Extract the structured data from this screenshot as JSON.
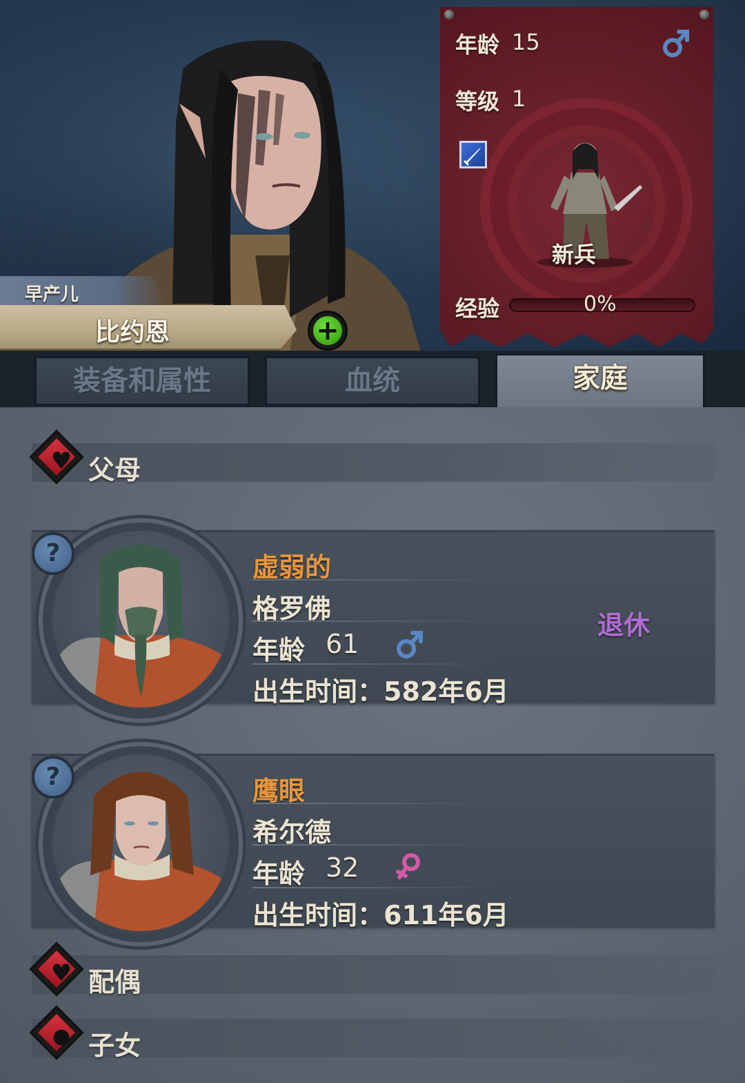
{
  "hero": {
    "trait": "早产儿",
    "name": "比约恩",
    "add_button": "+"
  },
  "banner": {
    "age_label": "年龄",
    "age_value": "15",
    "level_label": "等级",
    "level_value": "1",
    "class_name": "新兵",
    "xp_label": "经验",
    "xp_value": "0%",
    "xp_fraction": 0.0,
    "gender_icon": "male-icon",
    "class_icon": "dagger-icon"
  },
  "tabs": [
    {
      "label": "装备和属性",
      "active": false
    },
    {
      "label": "血统",
      "active": false
    },
    {
      "label": "家庭",
      "active": true
    }
  ],
  "sections": {
    "parents": {
      "label": "父母",
      "icon": "heart-icon"
    },
    "spouse": {
      "label": "配偶",
      "icon": "heart-icon"
    },
    "children": {
      "label": "子女",
      "icon": "person-icon"
    }
  },
  "parents": [
    {
      "trait": "虚弱的",
      "name": "格罗佛",
      "age_label": "年龄",
      "age": "61",
      "gender": "male",
      "birth": "出生时间：582年6月",
      "status": "退休",
      "help": "?"
    },
    {
      "trait": "鹰眼",
      "name": "希尔德",
      "age_label": "年龄",
      "age": "32",
      "gender": "female",
      "birth": "出生时间：611年6月",
      "help": "?"
    }
  ],
  "colors": {
    "trait_orange": "#e8963c",
    "retire_purple": "#b06bd3",
    "male_blue": "#5a86c4",
    "female_pink": "#d25aa8",
    "banner_red": "#66202a"
  }
}
